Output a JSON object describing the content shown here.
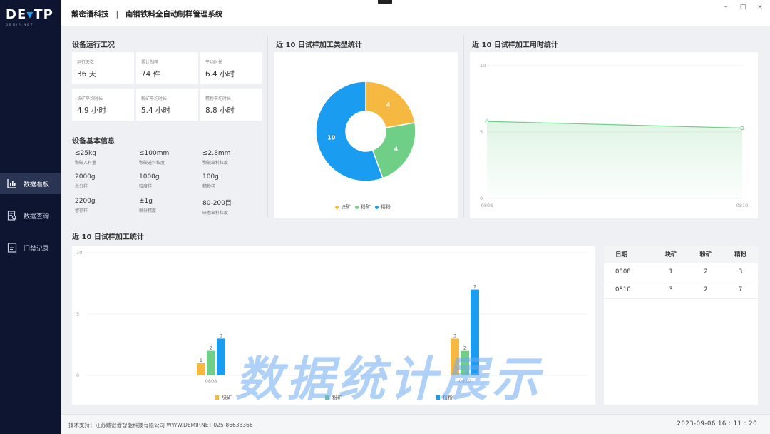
{
  "app": {
    "logo_main_a": "DE",
    "logo_main_b": "TP",
    "logo_sub": "DEMIP.NET",
    "company": "戴密谱科技",
    "separator": "|",
    "system_title": "南钢铁料全自动制样管理系统",
    "window": {
      "minimize": "–",
      "maximize": "□",
      "close": "×"
    }
  },
  "nav": {
    "items": [
      {
        "label": "数据看板",
        "icon": "bar-chart-icon",
        "active": true
      },
      {
        "label": "数据查询",
        "icon": "search-doc-icon",
        "active": false
      },
      {
        "label": "门禁记录",
        "icon": "list-doc-icon",
        "active": false
      }
    ]
  },
  "status": {
    "title": "设备运行工况",
    "cards": [
      {
        "label": "运行天数",
        "value": "36 天"
      },
      {
        "label": "累计制样",
        "value": "74 件"
      },
      {
        "label": "平均时长",
        "value": "6.4 小时"
      },
      {
        "label": "块矿平均时长",
        "value": "4.9 小时"
      },
      {
        "label": "粉矿平均时长",
        "value": "5.4 小时"
      },
      {
        "label": "精粉平均时长",
        "value": "8.8 小时"
      }
    ]
  },
  "info": {
    "title": "设备基本信息",
    "items": [
      {
        "value": "≤25kg",
        "label": "颚破入料量"
      },
      {
        "value": "≤100mm",
        "label": "颚破进料粒度"
      },
      {
        "value": "≤2.8mm",
        "label": "颚破出料粒度"
      },
      {
        "value": "2000g",
        "label": "水分样"
      },
      {
        "value": "1000g",
        "label": "粒度样"
      },
      {
        "value": "100g",
        "label": "精粉样"
      },
      {
        "value": "2200g",
        "label": "留存样"
      },
      {
        "value": "±1g",
        "label": "缩分精度"
      },
      {
        "value": "80-200目",
        "label": "研磨出料粒度"
      }
    ]
  },
  "colors": {
    "block": "#f5b942",
    "powder": "#6fcf86",
    "fine": "#1a9cf0"
  },
  "chart_data": [
    {
      "type": "pie",
      "title": "近 10 日试样加工类型统计",
      "categories": [
        "块矿",
        "粉矿",
        "精粉"
      ],
      "values": [
        4,
        4,
        10
      ],
      "legend": "bottom"
    },
    {
      "type": "line",
      "title": "近 10 日试样加工用时统计",
      "x": [
        "0808",
        "0810"
      ],
      "values": [
        5.8,
        5.3
      ],
      "ylim": [
        0,
        10
      ],
      "yticks": [
        "10",
        "5",
        "0"
      ]
    },
    {
      "type": "bar",
      "title": "近 10 日试样加工统计",
      "categories": [
        "0808",
        "0810"
      ],
      "series": [
        {
          "name": "块矿",
          "values": [
            1,
            3
          ]
        },
        {
          "name": "粉矿",
          "values": [
            2,
            2
          ]
        },
        {
          "name": "精粉",
          "values": [
            3,
            7
          ]
        }
      ],
      "ylim": [
        0,
        10
      ],
      "yticks": [
        "10",
        "5",
        "0"
      ],
      "legend": "bottom"
    }
  ],
  "table": {
    "headers": [
      "日期",
      "块矿",
      "粉矿",
      "精粉"
    ],
    "rows": [
      [
        "0808",
        "1",
        "2",
        "3"
      ],
      [
        "0810",
        "3",
        "2",
        "7"
      ]
    ]
  },
  "footer": {
    "support": "技术支持：江苏戴密谱智能科技有限公司  WWW.DEMIP.NET  025-86633366",
    "datetime": "2023-09-06  16 : 11 : 20"
  },
  "watermark": "数据统计展示"
}
